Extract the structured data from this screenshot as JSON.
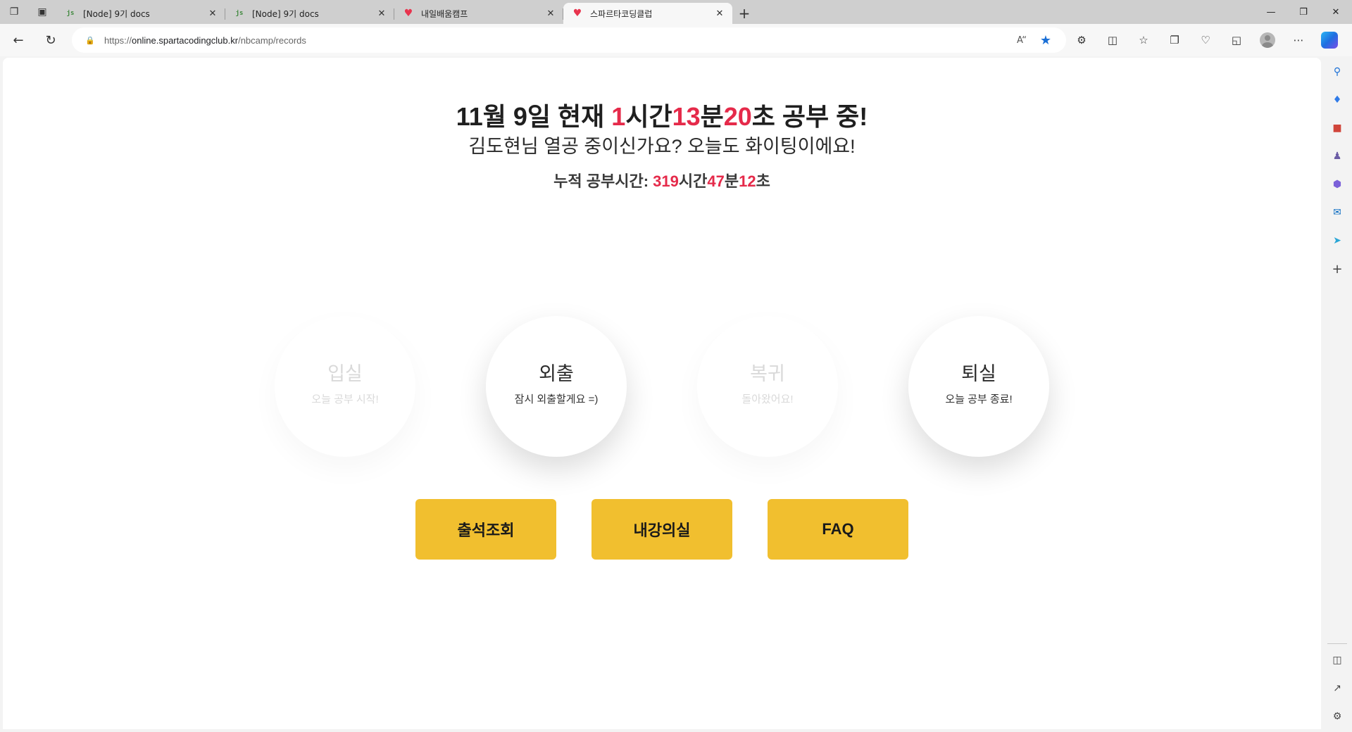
{
  "browser": {
    "tabs": [
      {
        "title": "[Node] 9기 docs",
        "favicon": "nodejs-icon",
        "active": false
      },
      {
        "title": "[Node] 9기 docs",
        "favicon": "nodejs-icon",
        "active": false
      },
      {
        "title": "내일배움캠프",
        "favicon": "sparta-heart-icon",
        "active": false
      },
      {
        "title": "스파르타코딩클럽",
        "favicon": "sparta-heart-icon",
        "active": true
      }
    ],
    "url_prefix": "https://",
    "url_host": "online.spartacodingclub.kr",
    "url_path": "/nbcamp/records",
    "accent_color": "#1a6fd6"
  },
  "page": {
    "headline": {
      "date": "11월 9일 현재 ",
      "hours": "1",
      "hours_unit": "시간",
      "minutes": "13",
      "minutes_unit": "분",
      "seconds": "20",
      "seconds_unit": "초 공부 중!"
    },
    "subline": "김도현님 열공 중이신가요? 오늘도 화이팅이에요!",
    "total": {
      "label": "누적 공부시간: ",
      "hours": "319",
      "hours_unit": "시간",
      "minutes": "47",
      "minutes_unit": "분",
      "seconds": "12",
      "seconds_unit": "초"
    },
    "actions": [
      {
        "label": "입실",
        "sub": "오늘 공부 시작!",
        "state": "disabled"
      },
      {
        "label": "외출",
        "sub": "잠시 외출할게요 =)",
        "state": "enabled"
      },
      {
        "label": "복귀",
        "sub": "돌아왔어요!",
        "state": "disabled"
      },
      {
        "label": "퇴실",
        "sub": "오늘 공부 종료!",
        "state": "enabled"
      }
    ],
    "buttons": [
      {
        "label": "출석조회"
      },
      {
        "label": "내강의실"
      },
      {
        "label": "FAQ"
      }
    ],
    "colors": {
      "highlight": "#e52a4a",
      "button_yellow": "#f1bf2f"
    }
  }
}
